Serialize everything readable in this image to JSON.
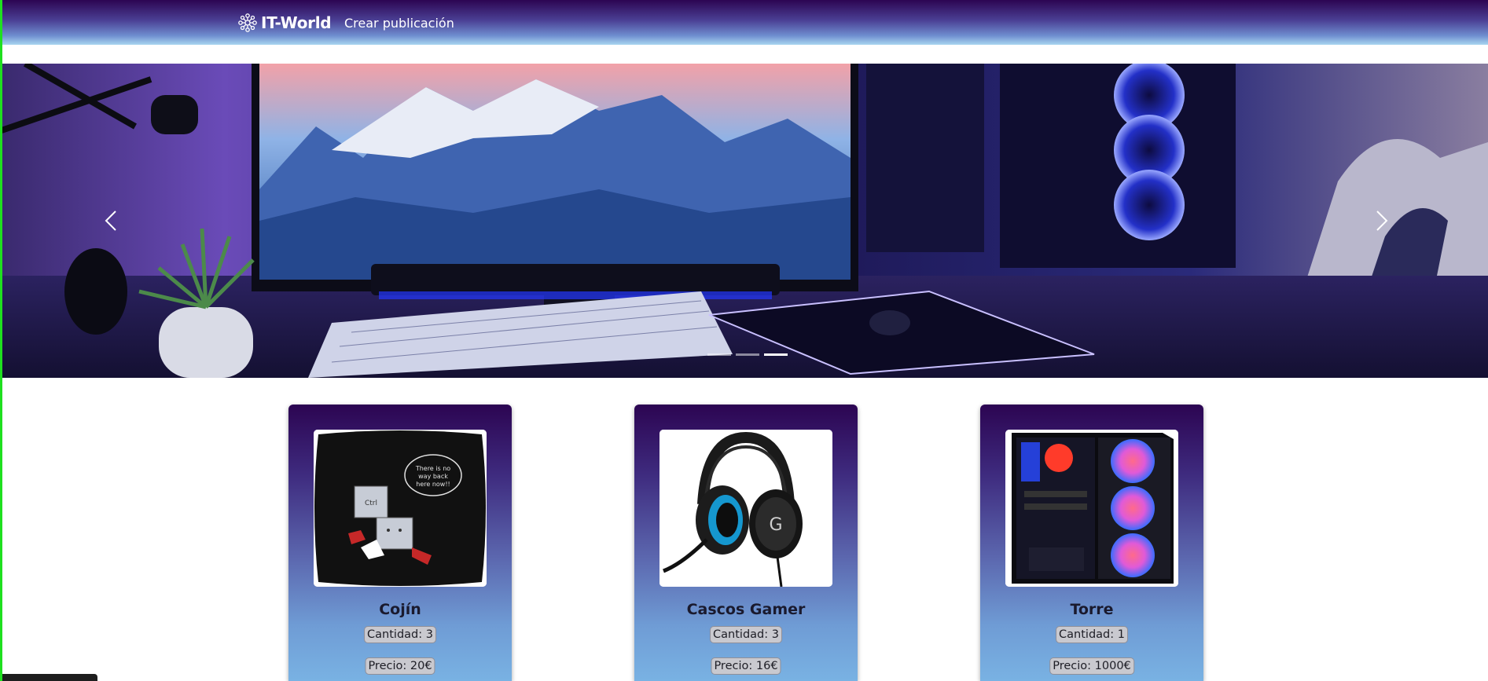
{
  "header": {
    "brand": "IT-World",
    "brand_icon": "network-logo-icon",
    "nav_link": "Crear publicación"
  },
  "carousel": {
    "slides": 3,
    "active_index": 2,
    "prev_icon": "chevron-left-icon",
    "next_icon": "chevron-right-icon"
  },
  "products": [
    {
      "title": "Cojín",
      "quantity": "Cantidad: 3",
      "price": "Precio: 20€",
      "image": "cushion-image"
    },
    {
      "title": "Cascos Gamer",
      "quantity": "Cantidad: 3",
      "price": "Precio: 16€",
      "image": "headset-image"
    },
    {
      "title": "Torre",
      "quantity": "Cantidad: 1",
      "price": "Precio: 1000€",
      "image": "pc-tower-image"
    }
  ],
  "colors": {
    "navbar_top": "#2c0552",
    "navbar_bottom": "#a8d6f0",
    "card_top": "#2c0552",
    "card_bottom": "#79b2e3",
    "pill_bg": "#c9c9cf"
  },
  "statusbar": {
    "text": ""
  }
}
